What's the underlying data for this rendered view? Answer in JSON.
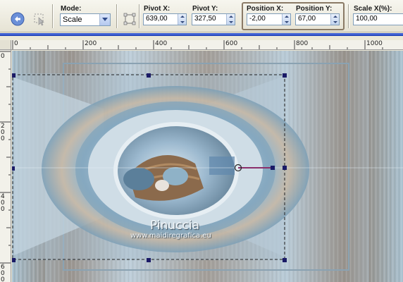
{
  "toolbar": {
    "mode_label": "Mode:",
    "mode_value": "Scale",
    "pivot_x_label": "Pivot X:",
    "pivot_x_value": "639,00",
    "pivot_y_label": "Pivot Y:",
    "pivot_y_value": "327,50",
    "position_x_label": "Position X:",
    "position_x_value": "-2,00",
    "position_y_label": "Position Y:",
    "position_y_value": "67,00",
    "scale_x_label": "Scale X(%):",
    "scale_x_value": "100,00"
  },
  "ruler": {
    "horizontal_ticks": [
      "0",
      "200",
      "400",
      "600",
      "800",
      "1000"
    ],
    "vertical_ticks": [
      "0",
      "200",
      "400",
      "600"
    ]
  },
  "canvas": {
    "watermark_name": "Pinuccia",
    "watermark_url": "www.maidiregrafica.eu"
  },
  "colors": {
    "accent_bar": "#3d5fd1",
    "toolbar_bg": "#ece9d8",
    "handle": "#1a1a66"
  }
}
